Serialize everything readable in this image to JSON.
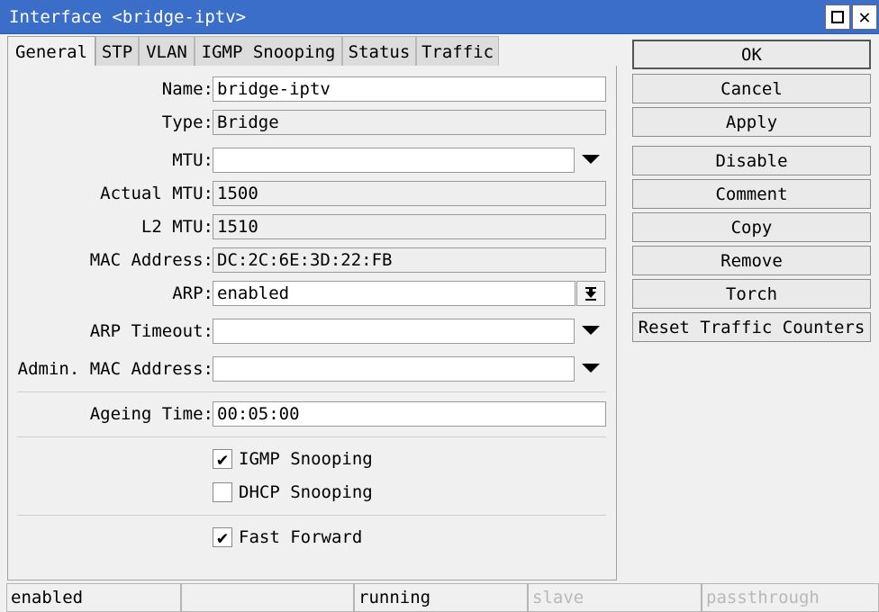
{
  "window": {
    "title": "Interface <bridge-iptv>",
    "maximize_icon": "maximize-icon",
    "close_label": "✕"
  },
  "tabs": [
    {
      "label": "General",
      "active": true
    },
    {
      "label": "STP"
    },
    {
      "label": "VLAN"
    },
    {
      "label": "IGMP Snooping"
    },
    {
      "label": "Status"
    },
    {
      "label": "Traffic"
    }
  ],
  "form": {
    "name": {
      "label": "Name:",
      "value": "bridge-iptv"
    },
    "type": {
      "label": "Type:",
      "value": "Bridge"
    },
    "mtu": {
      "label": "MTU:",
      "value": ""
    },
    "actual_mtu": {
      "label": "Actual MTU:",
      "value": "1500"
    },
    "l2_mtu": {
      "label": "L2 MTU:",
      "value": "1510"
    },
    "mac": {
      "label": "MAC Address:",
      "value": "DC:2C:6E:3D:22:FB"
    },
    "arp": {
      "label": "ARP:",
      "value": "enabled"
    },
    "arp_timeout": {
      "label": "ARP Timeout:",
      "value": ""
    },
    "admin_mac": {
      "label": "Admin. MAC Address:",
      "value": ""
    },
    "ageing_time": {
      "label": "Ageing Time:",
      "value": "00:05:00"
    },
    "igmp_snooping": {
      "label": "IGMP Snooping",
      "checked": true
    },
    "dhcp_snooping": {
      "label": "DHCP Snooping",
      "checked": false
    },
    "fast_forward": {
      "label": "Fast Forward",
      "checked": true
    },
    "check_mark": "✔"
  },
  "buttons": {
    "ok": "OK",
    "cancel": "Cancel",
    "apply": "Apply",
    "disable": "Disable",
    "comment": "Comment",
    "copy": "Copy",
    "remove": "Remove",
    "torch": "Torch",
    "reset_traffic": "Reset Traffic Counters"
  },
  "status_bar": {
    "enabled": "enabled",
    "blank": "",
    "running": "running",
    "slave": "slave",
    "passthrough": "passthrough"
  },
  "colors": {
    "titlebar": "#3a6ec9",
    "dim_text": "#b8b8b8"
  }
}
